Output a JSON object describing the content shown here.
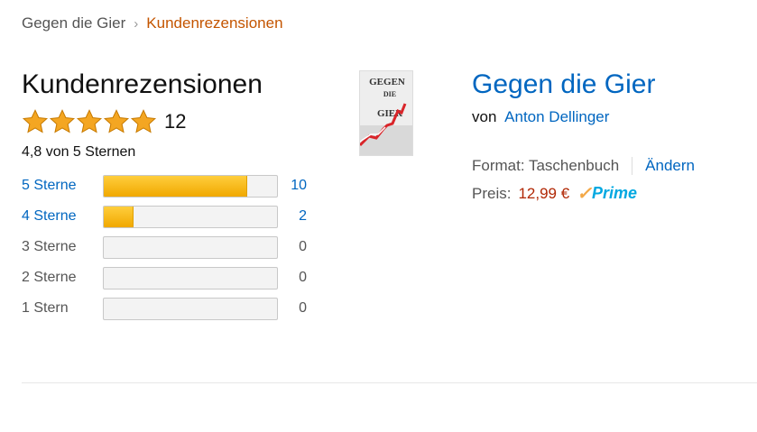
{
  "breadcrumb": {
    "home": "Gegen die Gier",
    "separator": "›",
    "current": "Kundenrezensionen"
  },
  "reviews": {
    "heading": "Kundenrezensionen",
    "star_icon": "star-icon",
    "stars_filled": 5,
    "rating_count": "12",
    "average_text": "4,8 von 5 Sternen",
    "histogram": [
      {
        "label": "5 Sterne",
        "count": "10",
        "percent": 83,
        "link": true
      },
      {
        "label": "4 Sterne",
        "count": "2",
        "percent": 17,
        "link": true
      },
      {
        "label": "3 Sterne",
        "count": "0",
        "percent": 0,
        "link": false
      },
      {
        "label": "2 Sterne",
        "count": "0",
        "percent": 0,
        "link": false
      },
      {
        "label": "1 Stern",
        "count": "0",
        "percent": 0,
        "link": false
      }
    ]
  },
  "cover": {
    "text_line1": "GEGEN",
    "text_line2": "DIE",
    "text_line3": "GIER"
  },
  "product": {
    "title": "Gegen die Gier",
    "by_label": "von",
    "author": "Anton Dellinger",
    "format_text": "Format: Taschenbuch",
    "change_label": "Ändern",
    "price_label": "Preis:",
    "price": "12,99 €",
    "prime_check": "✓",
    "prime_word": "Prime"
  },
  "colors": {
    "link": "#0066c0",
    "breadcrumb_current": "#c45500",
    "price": "#b12704",
    "star": "#f4a622",
    "prime_blue": "#00a8e1",
    "prime_orange": "#f3a847"
  }
}
